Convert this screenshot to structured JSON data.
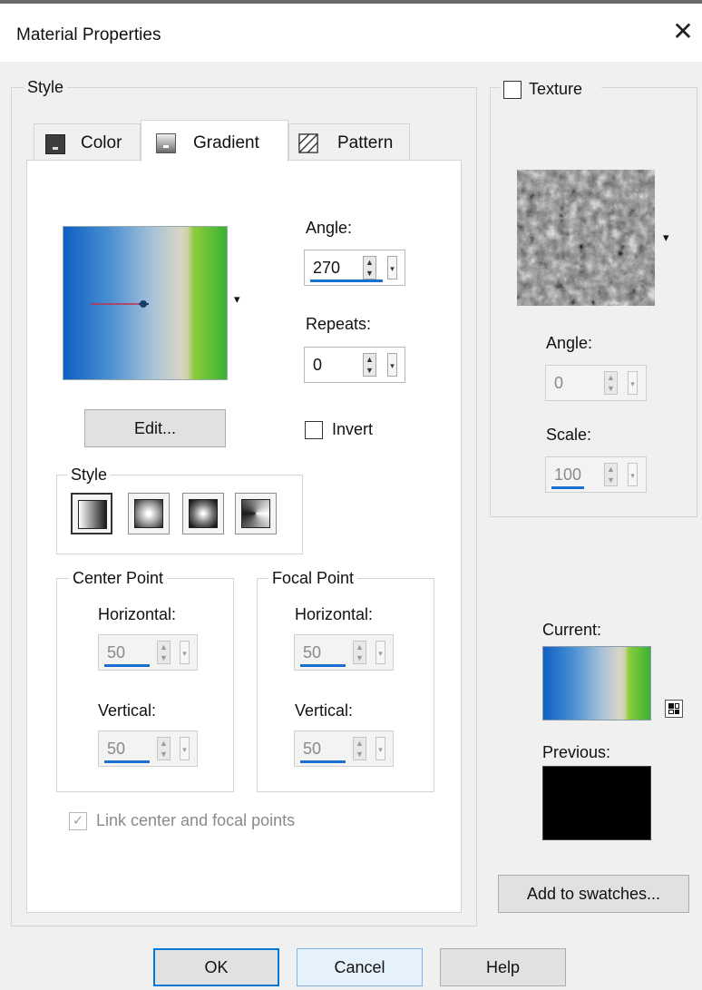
{
  "window": {
    "title": "Material Properties",
    "close_glyph": "✕"
  },
  "style_group": {
    "legend": "Style",
    "tabs": [
      {
        "label": "Color",
        "icon": "color-swatch-icon",
        "active": false
      },
      {
        "label": "Gradient",
        "icon": "gradient-icon",
        "active": true
      },
      {
        "label": "Pattern",
        "icon": "pattern-icon",
        "active": false
      }
    ],
    "gradient": {
      "preview_colors": [
        "#0f5fc3",
        "#4a8fd2",
        "#a9c2d8",
        "#d9d5c4",
        "#8ccc3a",
        "#38b233"
      ],
      "dropdown_glyph": "▾",
      "edit_button": "Edit...",
      "angle": {
        "label": "Angle:",
        "value": "270"
      },
      "repeats": {
        "label": "Repeats:",
        "value": "0"
      },
      "invert": {
        "label": "Invert",
        "checked": false
      },
      "style_sub": {
        "legend": "Style",
        "buttons": [
          "linear-gradient-style",
          "rectangular-gradient-style",
          "sunburst-gradient-style",
          "radial-gradient-style"
        ],
        "selected": "linear-gradient-style"
      },
      "center_point": {
        "legend": "Center Point",
        "horizontal_label": "Horizontal:",
        "horizontal_value": "50",
        "vertical_label": "Vertical:",
        "vertical_value": "50"
      },
      "focal_point": {
        "legend": "Focal Point",
        "horizontal_label": "Horizontal:",
        "horizontal_value": "50",
        "vertical_label": "Vertical:",
        "vertical_value": "50"
      },
      "link_points": {
        "label": "Link center and focal points",
        "checked": true,
        "enabled": false
      }
    }
  },
  "texture": {
    "label": "Texture",
    "checked": false,
    "dropdown_glyph": "▾",
    "angle": {
      "label": "Angle:",
      "value": "0"
    },
    "scale": {
      "label": "Scale:",
      "value": "100"
    }
  },
  "current": {
    "label": "Current:",
    "swap_icon": "swap-icon"
  },
  "previous": {
    "label": "Previous:",
    "color": "#000000"
  },
  "add_to_swatches": "Add to swatches...",
  "buttons": {
    "ok": "OK",
    "cancel": "Cancel",
    "help": "Help"
  },
  "spin_arrows": {
    "up": "▲",
    "down": "▼",
    "drop": "▾"
  },
  "check_glyph": "✓"
}
